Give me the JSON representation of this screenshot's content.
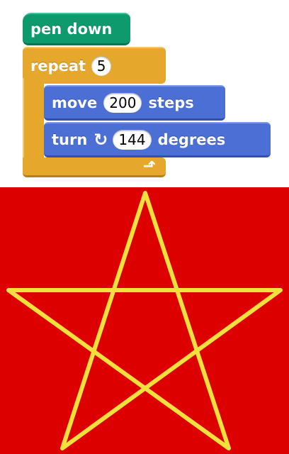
{
  "blocks": {
    "pen_down": {
      "label": "pen down",
      "color": "#0e9a6c"
    },
    "repeat": {
      "label": "repeat",
      "count": "5",
      "color": "#e6a82c",
      "loop_icon": "loop-arrow-icon"
    },
    "move": {
      "label": "move",
      "value": "200",
      "suffix": "steps",
      "color": "#4c6fd5"
    },
    "turn": {
      "label": "turn",
      "value": "144",
      "suffix": "degrees",
      "icon": "rotate-right-icon",
      "color": "#4c6fd5"
    }
  },
  "stage": {
    "background": "#dd0000",
    "star_color": "#f2e03c",
    "shape": "pentagram"
  }
}
